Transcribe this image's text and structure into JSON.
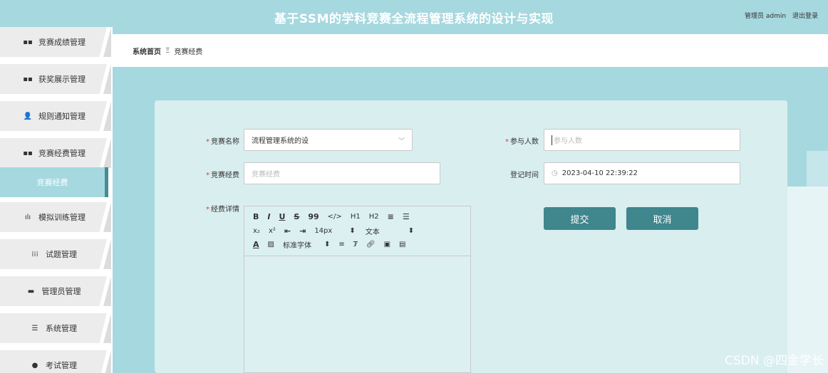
{
  "header": {
    "title": "基于SSM的学科竞赛全流程管理系统的设计与实现",
    "user_label": "管理员 admin",
    "logout_label": "退出登录"
  },
  "sidebar": {
    "items": [
      {
        "label": "竞赛成绩管理",
        "icon": "grid-icon",
        "glyph": "▪▪"
      },
      {
        "label": "获奖展示管理",
        "icon": "grid-icon",
        "glyph": "▪▪"
      },
      {
        "label": "规则通知管理",
        "icon": "user-icon",
        "glyph": "👤"
      },
      {
        "label": "竞赛经费管理",
        "icon": "grid-icon",
        "glyph": "▪▪"
      },
      {
        "label": "竞赛经费",
        "active": true
      },
      {
        "label": "模拟训练管理",
        "icon": "bar-chart-icon",
        "glyph": "ılı"
      },
      {
        "label": "试题管理",
        "icon": "grid-dots-icon",
        "glyph": "⁞⁞⁞"
      },
      {
        "label": "管理员管理",
        "icon": "monitor-icon",
        "glyph": "▬"
      },
      {
        "label": "系统管理",
        "icon": "list-icon",
        "glyph": "☰"
      },
      {
        "label": "考试管理",
        "icon": "location-icon",
        "glyph": "●"
      }
    ]
  },
  "breadcrumb": {
    "home": "系统首页",
    "separator": "Ξ",
    "current": "竞赛经费"
  },
  "form": {
    "competition_name": {
      "label": "竞赛名称",
      "value": "流程管理系统的设"
    },
    "participants": {
      "label": "参与人数",
      "placeholder": "参与人数"
    },
    "funding": {
      "label": "竞赛经费",
      "placeholder": "竞赛经费"
    },
    "register_time": {
      "label": "登记时间",
      "value": "2023-04-10 22:39:22"
    },
    "details": {
      "label": "经费详情"
    },
    "required_mark": "*"
  },
  "editor_toolbar": {
    "row1": [
      "B",
      "I",
      "U",
      "S",
      "99",
      "</>",
      "H1",
      "H2",
      "≡",
      "☰"
    ],
    "row2": [
      "x₂",
      "x²",
      "⇤",
      "⇥"
    ],
    "font_size": "14px",
    "block_type": "文本",
    "font_family": "标准字体",
    "select_arrow": "⬍"
  },
  "buttons": {
    "submit": "提交",
    "cancel": "取消"
  },
  "watermark": "CSDN @四金学长",
  "colors": {
    "header_bg": "#a6d8df",
    "button_bg": "#3f868d",
    "card_bg": "#d9eeef",
    "required": "#e4393c"
  }
}
